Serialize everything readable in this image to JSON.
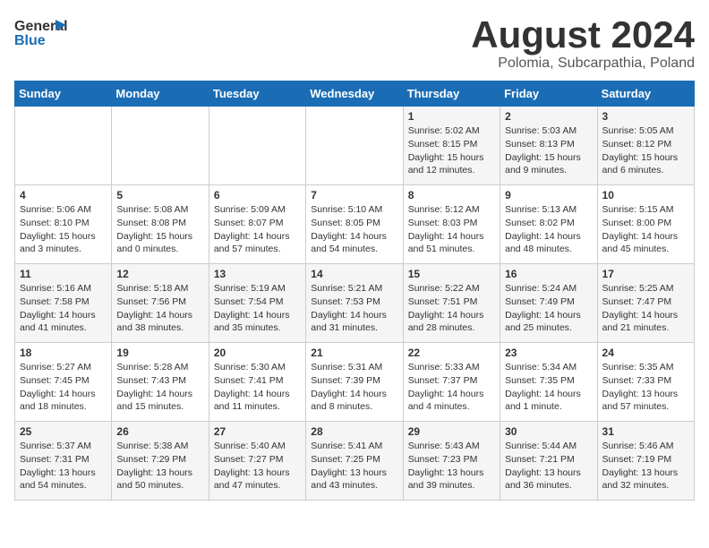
{
  "header": {
    "logo_general": "General",
    "logo_blue": "Blue",
    "title": "August 2024",
    "location": "Polomia, Subcarpathia, Poland"
  },
  "calendar": {
    "weekdays": [
      "Sunday",
      "Monday",
      "Tuesday",
      "Wednesday",
      "Thursday",
      "Friday",
      "Saturday"
    ],
    "weeks": [
      [
        {
          "day": "",
          "info": ""
        },
        {
          "day": "",
          "info": ""
        },
        {
          "day": "",
          "info": ""
        },
        {
          "day": "",
          "info": ""
        },
        {
          "day": "1",
          "info": "Sunrise: 5:02 AM\nSunset: 8:15 PM\nDaylight: 15 hours\nand 12 minutes."
        },
        {
          "day": "2",
          "info": "Sunrise: 5:03 AM\nSunset: 8:13 PM\nDaylight: 15 hours\nand 9 minutes."
        },
        {
          "day": "3",
          "info": "Sunrise: 5:05 AM\nSunset: 8:12 PM\nDaylight: 15 hours\nand 6 minutes."
        }
      ],
      [
        {
          "day": "4",
          "info": "Sunrise: 5:06 AM\nSunset: 8:10 PM\nDaylight: 15 hours\nand 3 minutes."
        },
        {
          "day": "5",
          "info": "Sunrise: 5:08 AM\nSunset: 8:08 PM\nDaylight: 15 hours\nand 0 minutes."
        },
        {
          "day": "6",
          "info": "Sunrise: 5:09 AM\nSunset: 8:07 PM\nDaylight: 14 hours\nand 57 minutes."
        },
        {
          "day": "7",
          "info": "Sunrise: 5:10 AM\nSunset: 8:05 PM\nDaylight: 14 hours\nand 54 minutes."
        },
        {
          "day": "8",
          "info": "Sunrise: 5:12 AM\nSunset: 8:03 PM\nDaylight: 14 hours\nand 51 minutes."
        },
        {
          "day": "9",
          "info": "Sunrise: 5:13 AM\nSunset: 8:02 PM\nDaylight: 14 hours\nand 48 minutes."
        },
        {
          "day": "10",
          "info": "Sunrise: 5:15 AM\nSunset: 8:00 PM\nDaylight: 14 hours\nand 45 minutes."
        }
      ],
      [
        {
          "day": "11",
          "info": "Sunrise: 5:16 AM\nSunset: 7:58 PM\nDaylight: 14 hours\nand 41 minutes."
        },
        {
          "day": "12",
          "info": "Sunrise: 5:18 AM\nSunset: 7:56 PM\nDaylight: 14 hours\nand 38 minutes."
        },
        {
          "day": "13",
          "info": "Sunrise: 5:19 AM\nSunset: 7:54 PM\nDaylight: 14 hours\nand 35 minutes."
        },
        {
          "day": "14",
          "info": "Sunrise: 5:21 AM\nSunset: 7:53 PM\nDaylight: 14 hours\nand 31 minutes."
        },
        {
          "day": "15",
          "info": "Sunrise: 5:22 AM\nSunset: 7:51 PM\nDaylight: 14 hours\nand 28 minutes."
        },
        {
          "day": "16",
          "info": "Sunrise: 5:24 AM\nSunset: 7:49 PM\nDaylight: 14 hours\nand 25 minutes."
        },
        {
          "day": "17",
          "info": "Sunrise: 5:25 AM\nSunset: 7:47 PM\nDaylight: 14 hours\nand 21 minutes."
        }
      ],
      [
        {
          "day": "18",
          "info": "Sunrise: 5:27 AM\nSunset: 7:45 PM\nDaylight: 14 hours\nand 18 minutes."
        },
        {
          "day": "19",
          "info": "Sunrise: 5:28 AM\nSunset: 7:43 PM\nDaylight: 14 hours\nand 15 minutes."
        },
        {
          "day": "20",
          "info": "Sunrise: 5:30 AM\nSunset: 7:41 PM\nDaylight: 14 hours\nand 11 minutes."
        },
        {
          "day": "21",
          "info": "Sunrise: 5:31 AM\nSunset: 7:39 PM\nDaylight: 14 hours\nand 8 minutes."
        },
        {
          "day": "22",
          "info": "Sunrise: 5:33 AM\nSunset: 7:37 PM\nDaylight: 14 hours\nand 4 minutes."
        },
        {
          "day": "23",
          "info": "Sunrise: 5:34 AM\nSunset: 7:35 PM\nDaylight: 14 hours\nand 1 minute."
        },
        {
          "day": "24",
          "info": "Sunrise: 5:35 AM\nSunset: 7:33 PM\nDaylight: 13 hours\nand 57 minutes."
        }
      ],
      [
        {
          "day": "25",
          "info": "Sunrise: 5:37 AM\nSunset: 7:31 PM\nDaylight: 13 hours\nand 54 minutes."
        },
        {
          "day": "26",
          "info": "Sunrise: 5:38 AM\nSunset: 7:29 PM\nDaylight: 13 hours\nand 50 minutes."
        },
        {
          "day": "27",
          "info": "Sunrise: 5:40 AM\nSunset: 7:27 PM\nDaylight: 13 hours\nand 47 minutes."
        },
        {
          "day": "28",
          "info": "Sunrise: 5:41 AM\nSunset: 7:25 PM\nDaylight: 13 hours\nand 43 minutes."
        },
        {
          "day": "29",
          "info": "Sunrise: 5:43 AM\nSunset: 7:23 PM\nDaylight: 13 hours\nand 39 minutes."
        },
        {
          "day": "30",
          "info": "Sunrise: 5:44 AM\nSunset: 7:21 PM\nDaylight: 13 hours\nand 36 minutes."
        },
        {
          "day": "31",
          "info": "Sunrise: 5:46 AM\nSunset: 7:19 PM\nDaylight: 13 hours\nand 32 minutes."
        }
      ]
    ]
  }
}
